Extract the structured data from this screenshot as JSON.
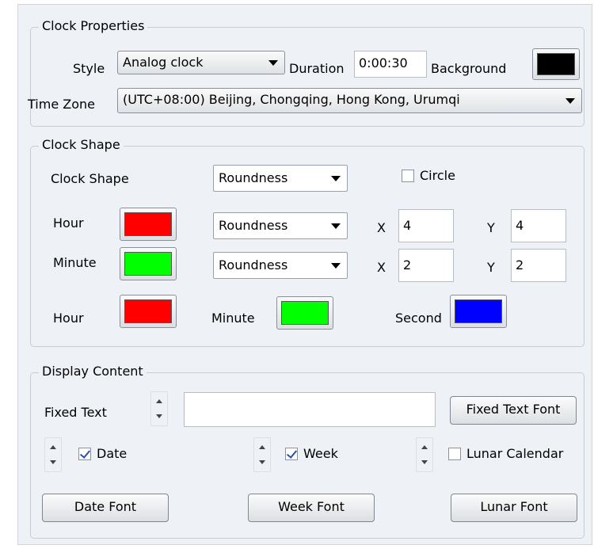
{
  "clock_properties": {
    "title": "Clock Properties",
    "style_label": "Style",
    "style_value": "Analog clock",
    "duration_label": "Duration",
    "duration_value": "0:00:30",
    "background_label": "Background",
    "background_color": "#000000",
    "timezone_label": "Time Zone",
    "timezone_value": "(UTC+08:00) Beijing, Chongqing, Hong Kong, Urumqi"
  },
  "clock_shape": {
    "title": "Clock Shape",
    "shape_label": "Clock Shape",
    "shape_value": "Roundness",
    "circle_label": "Circle",
    "circle_checked": false,
    "hour_label": "Hour",
    "hour_color": "#ff0000",
    "hour_shape": "Roundness",
    "hour_x_label": "X",
    "hour_x": "4",
    "hour_y_label": "Y",
    "hour_y": "4",
    "minute_label": "Minute",
    "minute_color": "#00ff00",
    "minute_shape": "Roundness",
    "minute_x_label": "X",
    "minute_x": "2",
    "minute_y_label": "Y",
    "minute_y": "2",
    "hand_hour_label": "Hour",
    "hand_hour_color": "#ff0000",
    "hand_minute_label": "Minute",
    "hand_minute_color": "#00ff00",
    "hand_second_label": "Second",
    "hand_second_color": "#0000ff"
  },
  "display_content": {
    "title": "Display Content",
    "fixed_text_label": "Fixed Text",
    "fixed_text_value": "",
    "fixed_text_font_button": "Fixed Text Font",
    "date_label": "Date",
    "date_checked": true,
    "week_label": "Week",
    "week_checked": true,
    "lunar_label": "Lunar Calendar",
    "lunar_checked": false,
    "date_font_button": "Date Font",
    "week_font_button": "Week Font",
    "lunar_font_button": "Lunar Font"
  }
}
